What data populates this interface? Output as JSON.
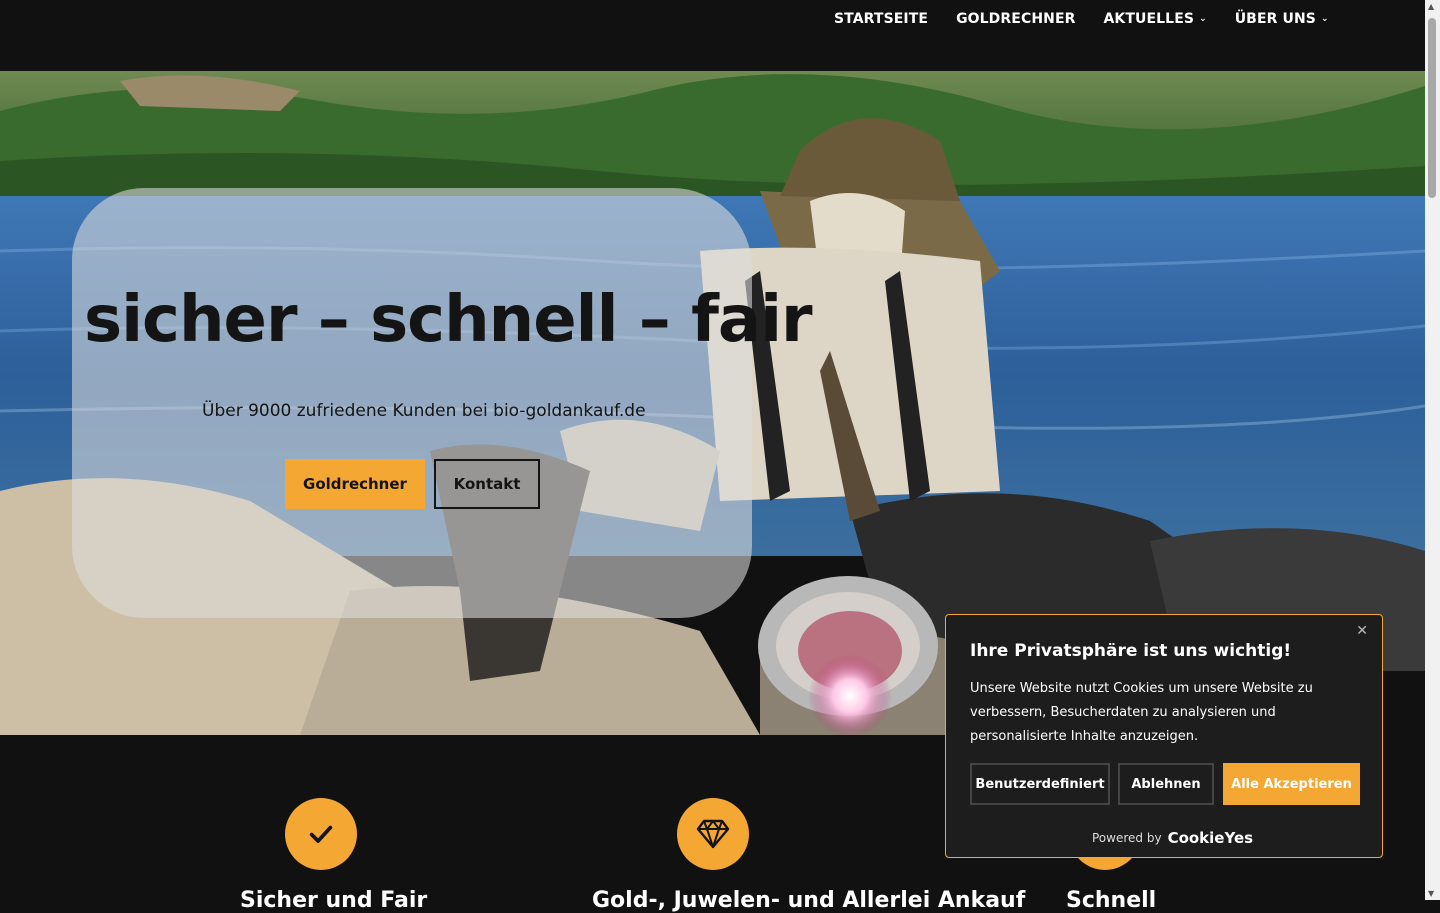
{
  "nav": {
    "items": [
      {
        "label": "STARTSEITE"
      },
      {
        "label": "GOLDRECHNER"
      },
      {
        "label": "AKTUELLES",
        "dropdown": true
      },
      {
        "label": "ÜBER UNS",
        "dropdown": true
      }
    ]
  },
  "hero": {
    "headline": "sicher – schnell – fair",
    "subline": "Über 9000 zufriedene Kunden bei bio-goldankauf.de",
    "primary_button": "Goldrechner",
    "secondary_button": "Kontakt"
  },
  "features": [
    {
      "icon": "check-icon",
      "title": "Sicher und Fair"
    },
    {
      "icon": "diamond-icon",
      "title": "Gold-, Juwelen- und Allerlei Ankauf"
    },
    {
      "icon": "clock-icon",
      "title": "Schnell"
    }
  ],
  "cookie": {
    "title": "Ihre Privatsphäre ist uns wichtig!",
    "text": "Unsere Website nutzt Cookies um unsere Website zu verbessern, Besucherdaten zu analysieren und personalisierte Inhalte anzuzeigen.",
    "custom_button": "Benutzerdefiniert",
    "reject_button": "Ablehnen",
    "accept_button": "Alle Akzeptieren",
    "powered_by": "Powered by",
    "brand": "CookieYes"
  },
  "colors": {
    "accent": "#f5a733",
    "header_bg": "#111111",
    "cookie_bg": "#1d1d1d"
  }
}
